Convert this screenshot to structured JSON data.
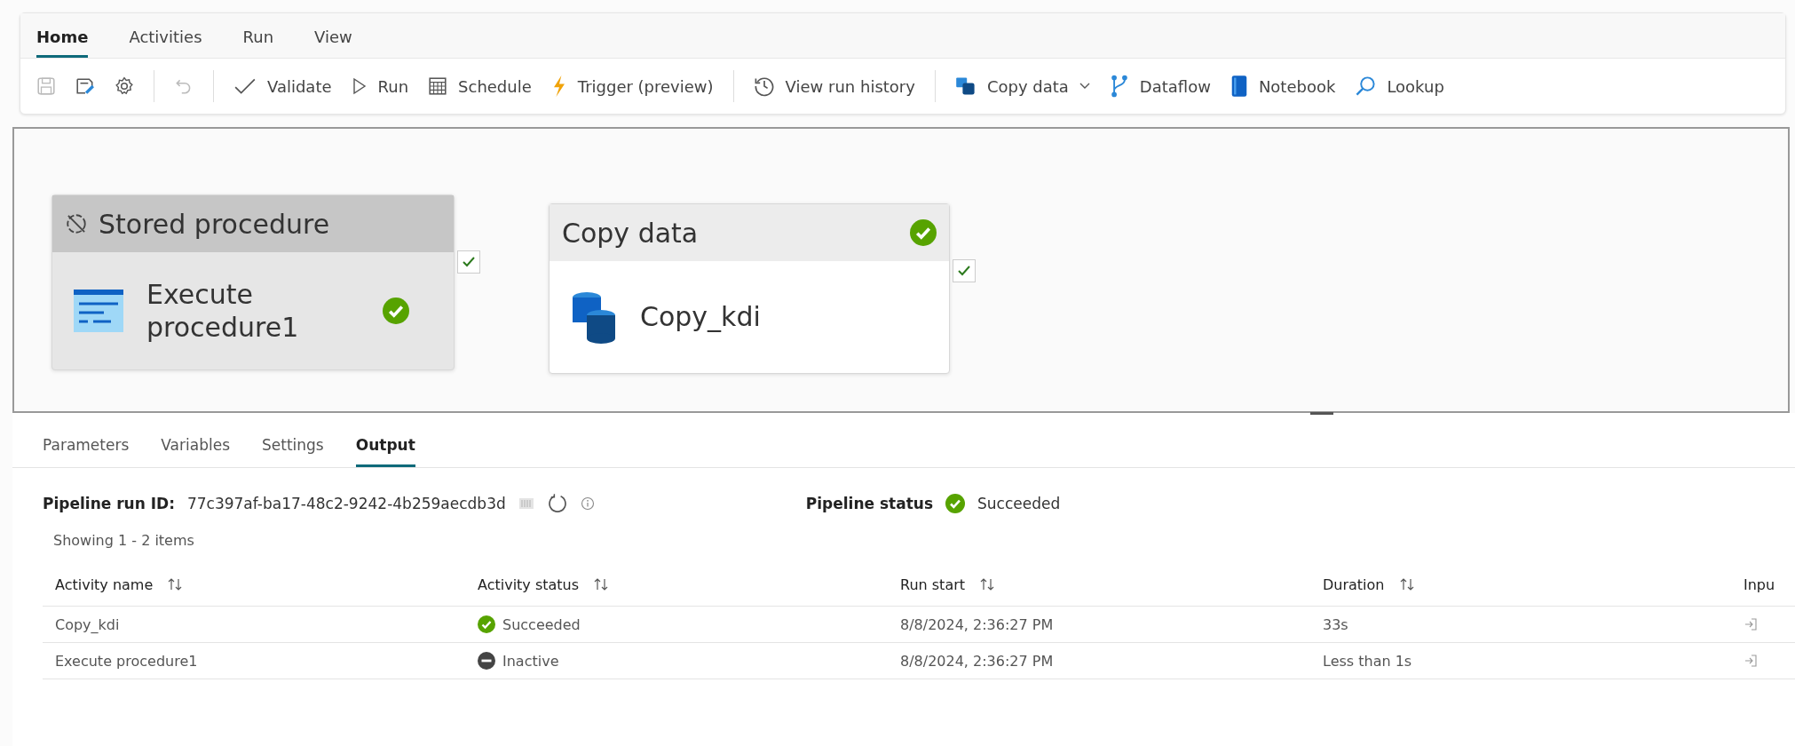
{
  "tabs": [
    {
      "label": "Home",
      "selected": true
    },
    {
      "label": "Activities",
      "selected": false
    },
    {
      "label": "Run",
      "selected": false
    },
    {
      "label": "View",
      "selected": false
    }
  ],
  "toolbar": [
    {
      "kind": "save",
      "disabled": true
    },
    {
      "kind": "publish",
      "disabled": false
    },
    {
      "kind": "settings",
      "disabled": false
    },
    {
      "kind": "divider"
    },
    {
      "kind": "undo",
      "disabled": true
    },
    {
      "kind": "divider"
    },
    {
      "kind": "validate",
      "label": "Validate"
    },
    {
      "kind": "run",
      "label": "Run"
    },
    {
      "kind": "schedule",
      "label": "Schedule"
    },
    {
      "kind": "trigger",
      "label": "Trigger (preview)"
    },
    {
      "kind": "divider"
    },
    {
      "kind": "history",
      "label": "View run history"
    },
    {
      "kind": "divider"
    },
    {
      "kind": "copy",
      "label": "Copy data",
      "dropdown": true
    },
    {
      "kind": "dataflow",
      "label": "Dataflow"
    },
    {
      "kind": "notebook",
      "label": "Notebook"
    },
    {
      "kind": "lookup",
      "label": "Lookup"
    }
  ],
  "activities": [
    {
      "type": "Stored procedure",
      "name": "Execute procedure1",
      "kind": "procedure",
      "deactivated": true,
      "succeeded": true
    },
    {
      "type": "Copy data",
      "name": "Copy_kdi",
      "kind": "copy",
      "deactivated": false,
      "succeeded": true
    }
  ],
  "panel_tabs": [
    {
      "label": "Parameters",
      "selected": false
    },
    {
      "label": "Variables",
      "selected": false
    },
    {
      "label": "Settings",
      "selected": false
    },
    {
      "label": "Output",
      "selected": true
    }
  ],
  "run_id_label": "Pipeline run ID:",
  "run_id": "77c397af-ba17-48c2-9242-4b259aecdb3d",
  "pipeline_status_label": "Pipeline status",
  "pipeline_status": "Succeeded",
  "showing": "Showing 1 - 2 items",
  "table": {
    "columns": [
      "Activity name",
      "Activity status",
      "Run start",
      "Duration",
      "Inpu"
    ],
    "rows": [
      {
        "name": "Copy_kdi",
        "status": "Succeeded",
        "kind": "succeeded",
        "start": "8/8/2024, 2:36:27 PM",
        "duration": "33s"
      },
      {
        "name": "Execute procedure1",
        "status": "Inactive",
        "kind": "inactive",
        "start": "8/8/2024, 2:36:27 PM",
        "duration": "Less than 1s"
      }
    ]
  }
}
